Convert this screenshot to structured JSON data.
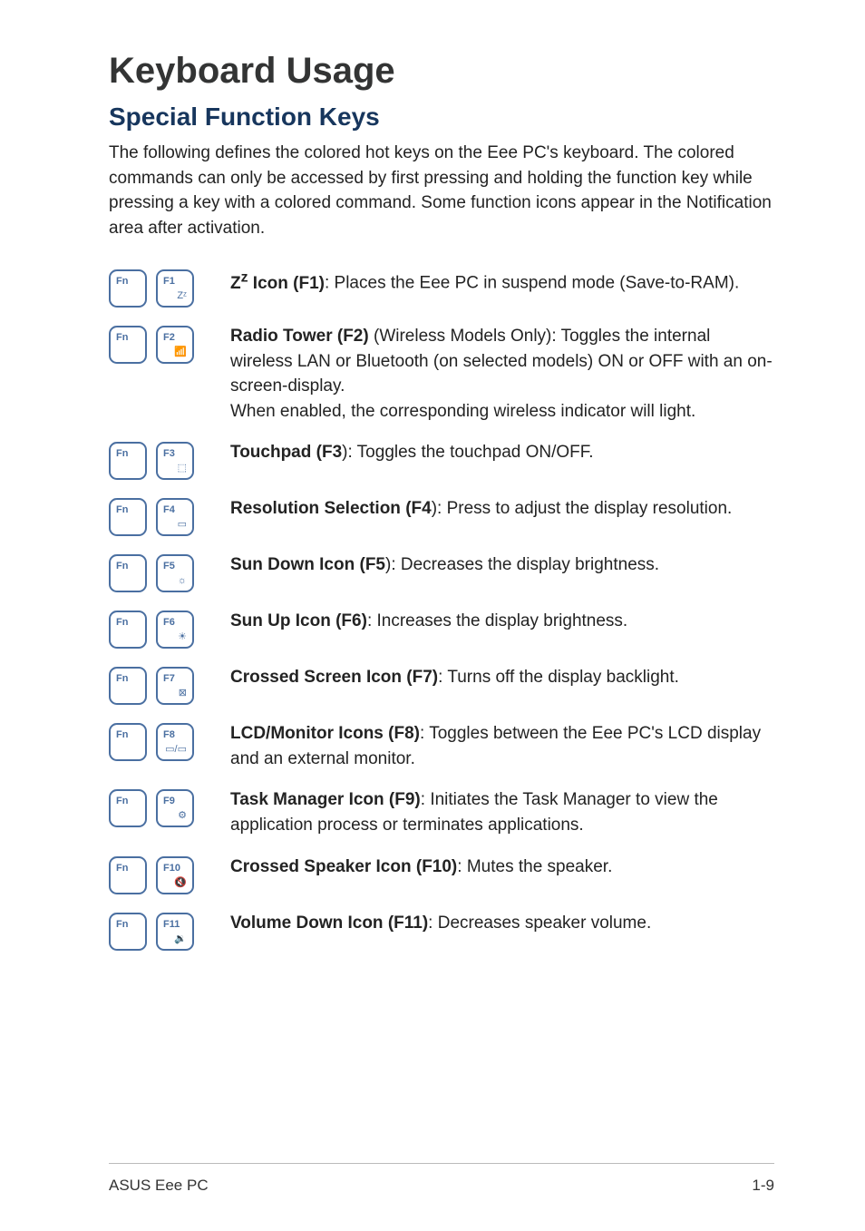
{
  "heading": "Keyboard Usage",
  "subheading": "Special Function Keys",
  "intro": "The following defines the colored hot keys on the Eee PC's keyboard. The colored commands can only be accessed by first pressing and holding the function key while pressing a key with a colored command. Some function icons appear in the Notification area after activation.",
  "fnLabel": "Fn",
  "rows": [
    {
      "keyLabel": "F1",
      "glyph": "Zᶻ",
      "title_html": "Z<sup>z</sup> Icon (F1)",
      "desc_html": ": Places the Eee PC in suspend mode (Save-to-RAM)."
    },
    {
      "keyLabel": "F2",
      "glyph": "📶",
      "title": "Radio Tower (F2)",
      "desc_html": " (Wireless Models Only): Toggles the internal wireless LAN or Bluetooth (on selected models) ON or OFF with an on-screen-display.<br>When enabled, the corresponding wireless indicator will light."
    },
    {
      "keyLabel": "F3",
      "glyph": "⬚",
      "title": "Touchpad (F3",
      "desc": "): Toggles the touchpad ON/OFF."
    },
    {
      "keyLabel": "F4",
      "glyph": "▭",
      "title": "Resolution Selection (F4",
      "desc": "): Press to adjust the display resolution."
    },
    {
      "keyLabel": "F5",
      "glyph": "☼",
      "title": "Sun Down Icon (F5",
      "desc": "): Decreases the display brightness."
    },
    {
      "keyLabel": "F6",
      "glyph": "☀",
      "title": "Sun Up Icon (F6)",
      "desc": ": Increases the display brightness."
    },
    {
      "keyLabel": "F7",
      "glyph": "⊠",
      "title": "Crossed Screen Icon (F7)",
      "desc": ": Turns off the display backlight."
    },
    {
      "keyLabel": "F8",
      "glyph": "▭/▭",
      "title": "LCD/Monitor Icons (F8)",
      "desc": ": Toggles between the Eee PC's LCD display and an external monitor."
    },
    {
      "keyLabel": "F9",
      "glyph": "⚙",
      "title": "Task Manager Icon (F9)",
      "desc": ": Initiates the Task Manager to view the application process or terminates applications."
    },
    {
      "keyLabel": "F10",
      "glyph": "🔇",
      "title": "Crossed Speaker Icon (F10)",
      "desc": ": Mutes the speaker."
    },
    {
      "keyLabel": "F11",
      "glyph": "🔉",
      "title": "Volume Down Icon (F11)",
      "desc": ": Decreases speaker volume."
    }
  ],
  "footer": {
    "left": "ASUS Eee PC",
    "right": "1-9"
  }
}
